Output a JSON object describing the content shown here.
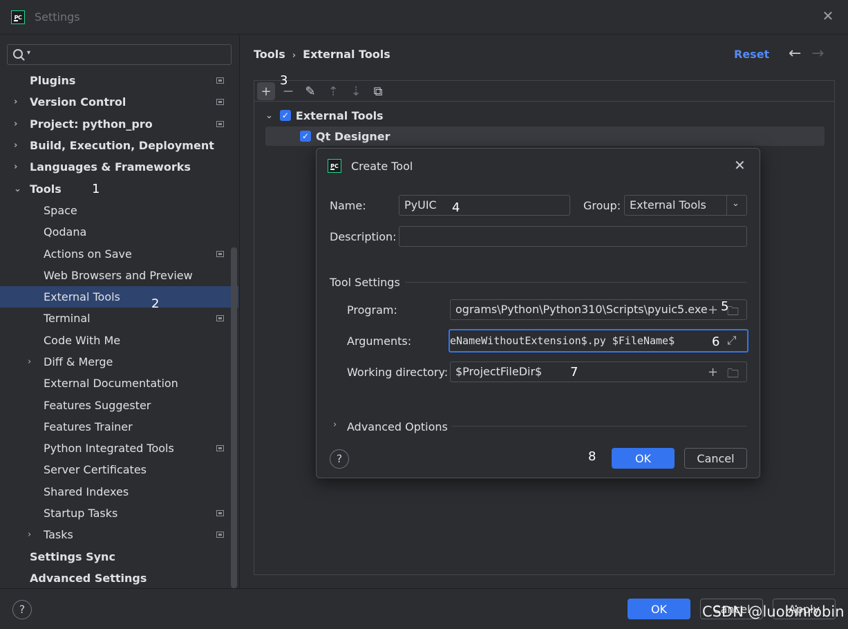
{
  "window": {
    "title": "Settings",
    "close_glyph": "✕"
  },
  "search": {
    "placeholder": ""
  },
  "sidebar": {
    "items": [
      {
        "label": "Plugins",
        "level": 0,
        "arrow": "",
        "badge": true,
        "selected": false
      },
      {
        "label": "Version Control",
        "level": 0,
        "arrow": "›",
        "badge": true,
        "selected": false
      },
      {
        "label": "Project: python_pro",
        "level": 0,
        "arrow": "›",
        "badge": true,
        "selected": false
      },
      {
        "label": "Build, Execution, Deployment",
        "level": 0,
        "arrow": "›",
        "badge": false,
        "selected": false
      },
      {
        "label": "Languages & Frameworks",
        "level": 0,
        "arrow": "›",
        "badge": false,
        "selected": false
      },
      {
        "label": "Tools",
        "level": 0,
        "arrow": "⌄",
        "badge": false,
        "selected": false
      },
      {
        "label": "Space",
        "level": 1,
        "arrow": "",
        "badge": false,
        "selected": false
      },
      {
        "label": "Qodana",
        "level": 1,
        "arrow": "",
        "badge": false,
        "selected": false
      },
      {
        "label": "Actions on Save",
        "level": 1,
        "arrow": "",
        "badge": true,
        "selected": false
      },
      {
        "label": "Web Browsers and Preview",
        "level": 1,
        "arrow": "",
        "badge": false,
        "selected": false
      },
      {
        "label": "External Tools",
        "level": 1,
        "arrow": "",
        "badge": false,
        "selected": true
      },
      {
        "label": "Terminal",
        "level": 1,
        "arrow": "",
        "badge": true,
        "selected": false
      },
      {
        "label": "Code With Me",
        "level": 1,
        "arrow": "",
        "badge": false,
        "selected": false
      },
      {
        "label": "Diff & Merge",
        "level": 1,
        "arrow": "›",
        "badge": false,
        "selected": false
      },
      {
        "label": "External Documentation",
        "level": 1,
        "arrow": "",
        "badge": false,
        "selected": false
      },
      {
        "label": "Features Suggester",
        "level": 1,
        "arrow": "",
        "badge": false,
        "selected": false
      },
      {
        "label": "Features Trainer",
        "level": 1,
        "arrow": "",
        "badge": false,
        "selected": false
      },
      {
        "label": "Python Integrated Tools",
        "level": 1,
        "arrow": "",
        "badge": true,
        "selected": false
      },
      {
        "label": "Server Certificates",
        "level": 1,
        "arrow": "",
        "badge": false,
        "selected": false
      },
      {
        "label": "Shared Indexes",
        "level": 1,
        "arrow": "",
        "badge": false,
        "selected": false
      },
      {
        "label": "Startup Tasks",
        "level": 1,
        "arrow": "",
        "badge": true,
        "selected": false
      },
      {
        "label": "Tasks",
        "level": 1,
        "arrow": "›",
        "badge": true,
        "selected": false
      },
      {
        "label": "Settings Sync",
        "level": 0,
        "arrow": "",
        "badge": false,
        "selected": false
      },
      {
        "label": "Advanced Settings",
        "level": 0,
        "arrow": "",
        "badge": false,
        "selected": false
      }
    ]
  },
  "header": {
    "breadcrumb_root": "Tools",
    "breadcrumb_sep": "›",
    "breadcrumb_leaf": "External Tools",
    "reset": "Reset",
    "back": "←",
    "forward": "→"
  },
  "toolbar": {
    "add": "+",
    "remove": "—",
    "edit": "✎",
    "up": "⇡",
    "down": "⇣",
    "copy": "⧉"
  },
  "tools_tree": {
    "group_label": "External Tools",
    "group_arrow": "⌄",
    "tool_label": "Qt Designer",
    "check": "✓"
  },
  "dialog": {
    "title": "Create Tool",
    "close": "✕",
    "name_label": "Name:",
    "name_value": "PyUIC",
    "group_label": "Group:",
    "group_value": "External Tools",
    "group_chevron": "⌄",
    "description_label": "Description:",
    "description_value": "",
    "tool_settings_label": "Tool Settings",
    "program_label": "Program:",
    "program_value": "ograms\\Python\\Python310\\Scripts\\pyuic5.exe",
    "arguments_label": "Arguments:",
    "arguments_value": "eNameWithoutExtension$.py $FileName$",
    "workdir_label": "Working directory:",
    "workdir_value": "$ProjectFileDir$",
    "advanced_label": "Advanced Options",
    "advanced_arrow": "›",
    "help": "?",
    "ok": "OK",
    "cancel": "Cancel",
    "plus_icon": "+",
    "folder_icon": "🗀",
    "expand_icon": "⤢"
  },
  "annotations": [
    "1",
    "2",
    "3",
    "4",
    "5",
    "6",
    "7",
    "8"
  ],
  "footer": {
    "help": "?",
    "ok": "OK",
    "cancel": "Cancel",
    "apply": "Apply"
  },
  "watermark": "CSDN @luobinrobin",
  "colors": {
    "accent": "#3574f0",
    "selection": "#2e436e",
    "link": "#548af7",
    "background": "#2b2d30"
  }
}
